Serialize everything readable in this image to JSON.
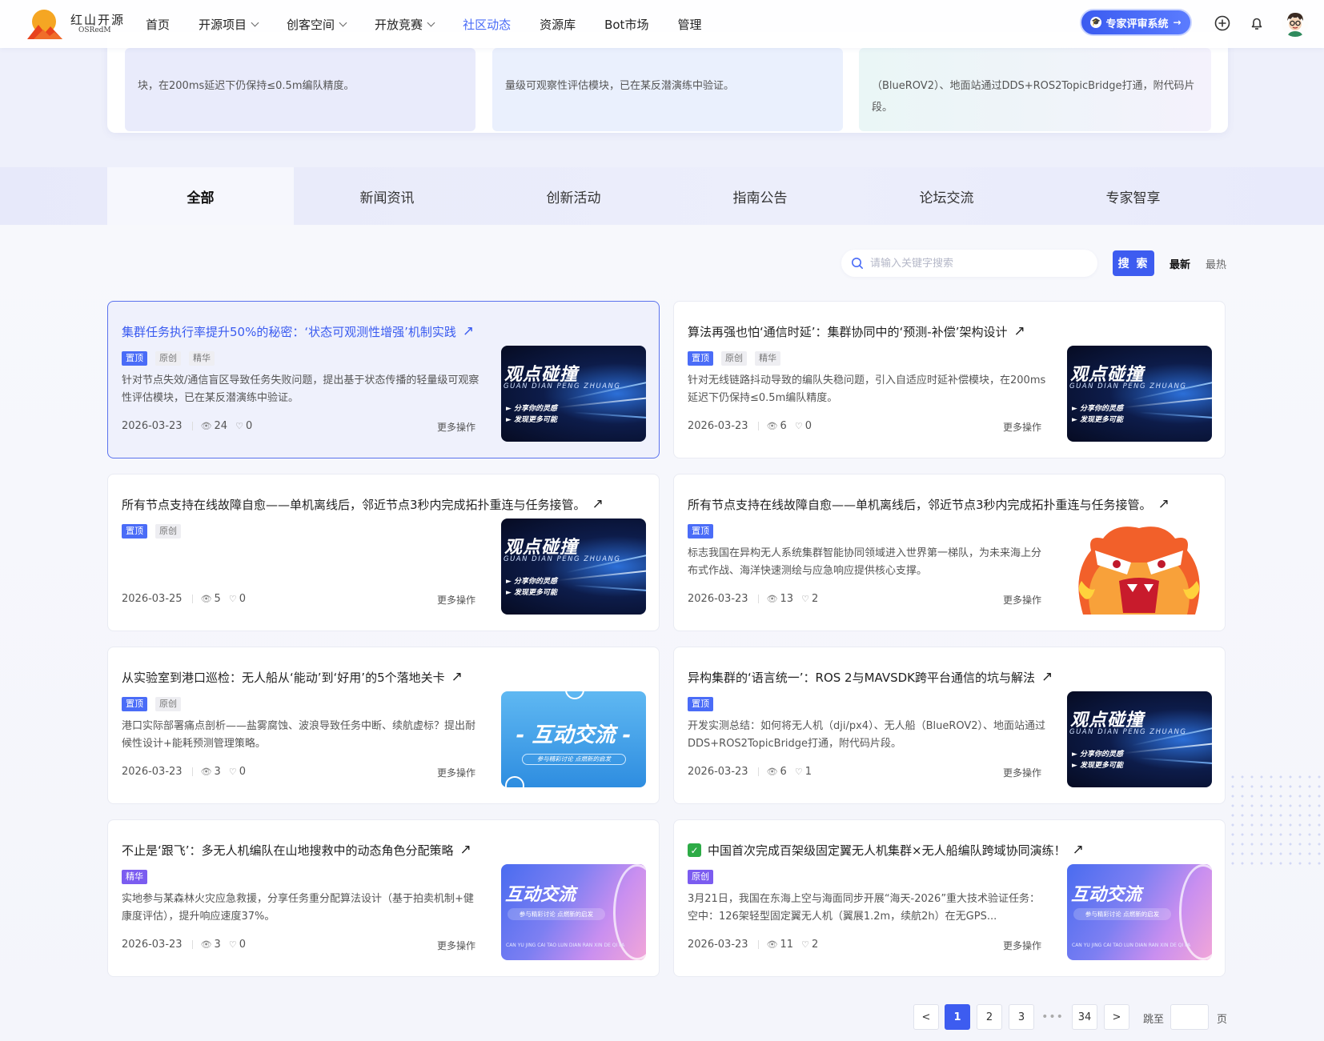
{
  "nav": {
    "logo_cn": "红山开源",
    "logo_en": "OSRedM",
    "menu": [
      {
        "label": "首页",
        "dropdown": false,
        "active": false
      },
      {
        "label": "开源项目",
        "dropdown": true,
        "active": false
      },
      {
        "label": "创客空间",
        "dropdown": true,
        "active": false
      },
      {
        "label": "开放竞赛",
        "dropdown": true,
        "active": false
      },
      {
        "label": "社区动态",
        "dropdown": false,
        "active": true
      },
      {
        "label": "资源库",
        "dropdown": false,
        "active": false
      },
      {
        "label": "Bot市场",
        "dropdown": false,
        "active": false
      },
      {
        "label": "管理",
        "dropdown": false,
        "active": false
      }
    ],
    "expert_button": "专家评审系统",
    "icons": [
      "plus-circle-icon",
      "bell-icon",
      "avatar"
    ]
  },
  "top_preview": [
    {
      "text": "块，在200ms延迟下仍保持≤0.5m编队精度。"
    },
    {
      "text": "量级可观察性评估模块，已在某反潜演练中验证。"
    },
    {
      "text": "（BlueROV2）、地面站通过DDS+ROS2TopicBridge打通，附代码片段。"
    }
  ],
  "tabs": [
    {
      "label": "全部",
      "active": true
    },
    {
      "label": "新闻资讯",
      "active": false
    },
    {
      "label": "创新活动",
      "active": false
    },
    {
      "label": "指南公告",
      "active": false
    },
    {
      "label": "论坛交流",
      "active": false
    },
    {
      "label": "专家智享",
      "active": false
    }
  ],
  "toolbar": {
    "search_placeholder": "请输入关键字搜索",
    "search_button": "搜 索",
    "sort_latest": "最新",
    "sort_hot": "最热"
  },
  "posts": [
    {
      "title": "集群任务执行率提升50%的秘密：‘状态可观测性增强’机制实践",
      "checked": false,
      "tags": [
        "置顶",
        "原创",
        "精华"
      ],
      "desc": "针对节点失效/通信盲区导致任务失败问题，提出基于状态传播的轻量级可观察性评估模块，已在某反潜演练中验证。",
      "date": "2026-03-23",
      "views": "24",
      "likes": "0",
      "more": "更多操作",
      "thumb": "dark",
      "highlight": true
    },
    {
      "title": "算法再强也怕‘通信时延’：集群协同中的‘预测-补偿’架构设计",
      "checked": false,
      "tags": [
        "置顶",
        "原创",
        "精华"
      ],
      "desc": "针对无线链路抖动导致的编队失稳问题，引入自适应时延补偿模块，在200ms延迟下仍保持≤0.5m编队精度。",
      "date": "2026-03-23",
      "views": "6",
      "likes": "0",
      "more": "更多操作",
      "thumb": "dark",
      "highlight": false
    },
    {
      "title": "所有节点支持在线故障自愈——单机离线后，邻近节点3秒内完成拓扑重连与任务接管。",
      "checked": false,
      "tags": [
        "置顶",
        "原创"
      ],
      "desc": "",
      "date": "2026-03-25",
      "views": "5",
      "likes": "0",
      "more": "更多操作",
      "thumb": "dark",
      "highlight": false
    },
    {
      "title": "所有节点支持在线故障自愈——单机离线后，邻近节点3秒内完成拓扑重连与任务接管。",
      "checked": false,
      "tags": [
        "置顶"
      ],
      "desc": "标志我国在异构无人系统集群智能协同领域进入世界第一梯队，为未来海上分布式作战、海洋快速测绘与应急响应提供核心支撑。",
      "date": "2026-03-23",
      "views": "13",
      "likes": "2",
      "more": "更多操作",
      "thumb": "face",
      "highlight": false
    },
    {
      "title": "从实验室到港口巡检：无人船从‘能动’到‘好用’的5个落地关卡",
      "checked": false,
      "tags": [
        "置顶",
        "原创"
      ],
      "desc": "港口实际部署痛点剖析——盐雾腐蚀、波浪导致任务中断、续航虚标？提出耐候性设计+能耗预测管理策略。",
      "date": "2026-03-23",
      "views": "3",
      "likes": "0",
      "more": "更多操作",
      "thumb": "blue",
      "highlight": false
    },
    {
      "title": "异构集群的‘语言统一’：ROS 2与MAVSDK跨平台通信的坑与解法",
      "checked": false,
      "tags": [
        "置顶"
      ],
      "desc": "开发实测总结：如何将无人机（dji/px4）、无人船（BlueROV2）、地面站通过DDS+ROS2TopicBridge打通，附代码片段。",
      "date": "2026-03-23",
      "views": "6",
      "likes": "1",
      "more": "更多操作",
      "thumb": "dark",
      "highlight": false
    },
    {
      "title": "不止是‘跟飞’：多无人机编队在山地搜救中的动态角色分配策略",
      "checked": false,
      "tags": [
        "精华"
      ],
      "desc": "实地参与某森林火灾应急救援，分享任务重分配算法设计（基于拍卖机制+健康度评估），提升响应速度37%。",
      "date": "2026-03-23",
      "views": "3",
      "likes": "0",
      "more": "更多操作",
      "thumb": "pink",
      "highlight": false
    },
    {
      "title": "中国首次完成百架级固定翼无人机集群×无人船编队跨域协同演练！",
      "checked": true,
      "tags": [
        "原创"
      ],
      "desc": "3月21日，我国在东海上空与海面同步开展“海天-2026”重大技术验证任务：空中：126架轻型固定翼无人机（翼展1.2m，续航2h）在无GPS...",
      "date": "2026-03-23",
      "views": "11",
      "likes": "2",
      "more": "更多操作",
      "thumb": "pink",
      "highlight": false
    }
  ],
  "thumb_text": {
    "dark_title": "观点碰撞",
    "dark_pinyin": "GUAN DIAN PENG ZHUANG",
    "dark_line1": "► 分享你的灵感",
    "dark_line2": "► 发现更多可能",
    "blue_title": "- 互动交流 -",
    "blue_sub": "参与精彩讨论 点燃新的启发",
    "pink_title": "互动交流",
    "pink_sub": "参与精彩讨论 点燃新的启发",
    "pink_pinyin": "CAN YU JING CAI TAO LUN DIAN RAN XIN DE QI FA"
  },
  "pagination": {
    "prev": "<",
    "pages": [
      "1",
      "2",
      "3"
    ],
    "dots": "•••",
    "last": "34",
    "next": ">",
    "current": "1",
    "jump_label": "跳至",
    "page_unit": "页"
  },
  "colors": {
    "accent": "#3d5cf0",
    "tag_top": "#4a6cf7",
    "tag_purple": "#7b5cf0"
  }
}
